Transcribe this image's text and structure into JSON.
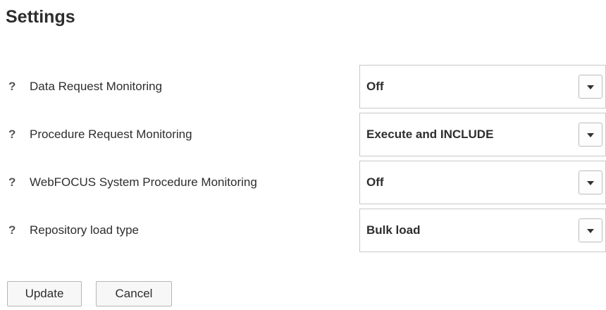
{
  "page": {
    "title": "Settings"
  },
  "settings": [
    {
      "help": "?",
      "label": "Data Request Monitoring",
      "value": "Off"
    },
    {
      "help": "?",
      "label": "Procedure Request Monitoring",
      "value": "Execute and INCLUDE"
    },
    {
      "help": "?",
      "label": "WebFOCUS System Procedure Monitoring",
      "value": "Off"
    },
    {
      "help": "?",
      "label": "Repository load type",
      "value": "Bulk load"
    }
  ],
  "buttons": {
    "update": "Update",
    "cancel": "Cancel"
  },
  "icons": {
    "help": "question-mark-icon",
    "dropdown": "chevron-down-icon"
  }
}
